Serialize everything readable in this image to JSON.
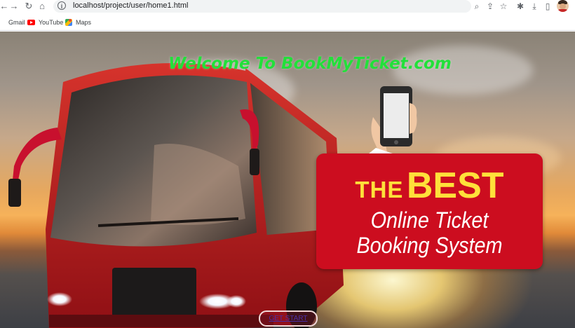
{
  "browser": {
    "url": "localhost/project/user/home1.html",
    "bookmarks": [
      {
        "label": "Gmail",
        "icon": "gmail-icon"
      },
      {
        "label": "YouTube",
        "icon": "youtube-icon"
      },
      {
        "label": "Maps",
        "icon": "maps-icon"
      }
    ],
    "toolbar_icons": [
      "back-icon",
      "forward-icon",
      "reload-icon",
      "home-icon",
      "info-icon",
      "zoom-icon",
      "share-icon",
      "star-icon",
      "extensions-icon",
      "download-icon",
      "side-panel-icon",
      "avatar"
    ]
  },
  "page": {
    "welcome_title": "Welcome To BookMyTicket.com",
    "promo": {
      "the": "THE",
      "best": "BEST",
      "line1": "Online Ticket",
      "line2": "Booking System"
    },
    "get_start_label": "GET START"
  },
  "colors": {
    "title_green": "#22e03a",
    "promo_red": "#cc0d1f",
    "promo_yellow": "#ffe03a",
    "bus_red": "#c8102e"
  }
}
